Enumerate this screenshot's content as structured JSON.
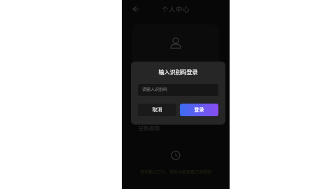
{
  "header": {
    "title": "个人中心",
    "back_icon": "back-arrow-icon"
  },
  "profile": {
    "user_icon": "user-icon"
  },
  "sections": {
    "purchased_label": "已购视频"
  },
  "empty_state": {
    "icon": "clock-icon",
    "hint": "请先输入口号，然后才能查看已购视频"
  },
  "modal": {
    "title": "输入识别码登录",
    "input": {
      "placeholder": "请输入识别码",
      "value": ""
    },
    "cancel_label": "取消",
    "login_label": "登录"
  },
  "colors": {
    "login_gradient_start": "#3b6cf0",
    "login_gradient_end": "#8a4df0",
    "modal_bg": "#262626"
  }
}
